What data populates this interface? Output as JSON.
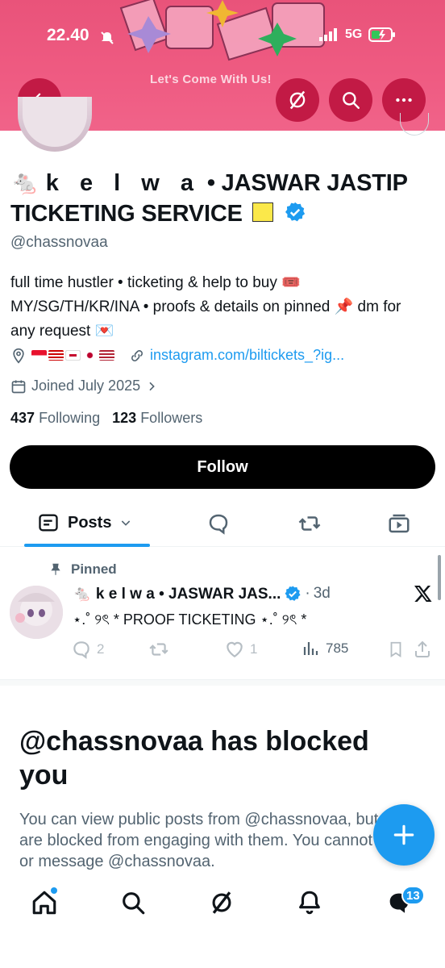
{
  "status_bar": {
    "time": "22.40",
    "network": "5G"
  },
  "banner": {
    "tagline": "Let's Come With Us!"
  },
  "header": {
    "back_icon": "arrow-left-icon",
    "grok_icon": "grok-icon",
    "search_icon": "search-icon",
    "more_icon": "more-horizontal-icon"
  },
  "profile": {
    "name_emoji": "🐁",
    "name_spaced": "k e l w a",
    "name_rest": " • JASWAR JASTIP TICKETING SERVICE",
    "verified": true,
    "handle": "@chassnovaa",
    "bio": "full time hustler • ticketing & help to buy 🎟️ MY/SG/TH/KR/INA • proofs & details on pinned 📌 dm for any request 💌",
    "link": "instagram.com/biltickets_?ig...",
    "joined": "Joined July 2025",
    "following_count": "437",
    "following_label": "Following",
    "followers_count": "123",
    "followers_label": "Followers",
    "follow_button": "Follow"
  },
  "tabs": {
    "active_label": "Posts",
    "items": [
      "posts",
      "replies",
      "reposts",
      "media"
    ]
  },
  "pinned_tweet": {
    "pinned_label": "Pinned",
    "author": "🐁 k e l w a • JASWAR JAS...",
    "time": "3d",
    "text": "⋆.˚ ୨ৎ * PROOF TICKETING ⋆.˚ ୨ৎ *",
    "replies": "2",
    "likes": "1",
    "views": "785"
  },
  "blocked": {
    "title": "@chassnovaa has blocked you",
    "body": "You can view public posts from @chassnovaa, but you are blocked from engaging with them. You cannot follow or message @chassnovaa."
  },
  "bottom_nav": {
    "items": [
      "home-icon",
      "search-icon",
      "grok-icon",
      "notifications-icon",
      "messages-icon"
    ],
    "messages_badge": "13"
  },
  "colors": {
    "banner": "#ef5b82",
    "accent": "#1d9bf0",
    "text": "#0f1419",
    "secondary": "#536471"
  }
}
